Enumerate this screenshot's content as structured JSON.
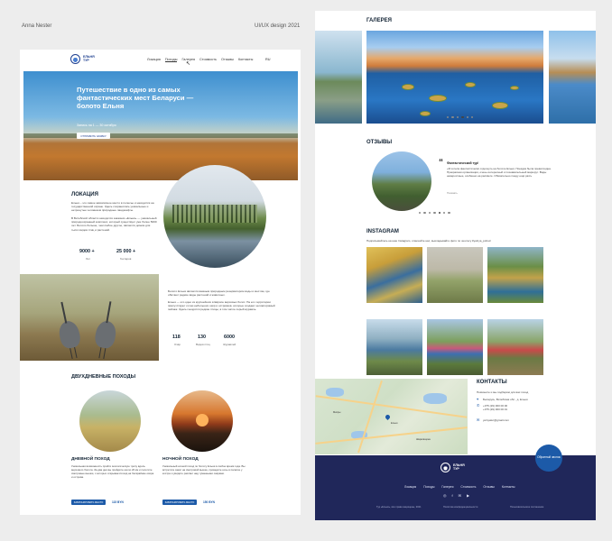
{
  "meta": {
    "author": "Anna Nester",
    "credit": "UI/UX design 2021"
  },
  "brand": {
    "name_line1": "ЕЛЬНЯ",
    "name_line2": "ТУР"
  },
  "nav": {
    "items": [
      "Локация",
      "Походы",
      "Галерея",
      "Стоимость",
      "Отзывы",
      "Контакты"
    ],
    "active": "Походы",
    "lang": "RU"
  },
  "hero": {
    "title": "Путешествие в одно из самых фантастических мест Беларуси — болото Ельня",
    "subtitle": "Запись на 1 — 30 октября",
    "button": "ОТПРАВИТЬ ЗАЯВКУ"
  },
  "location": {
    "heading": "ЛОКАЦИЯ",
    "para1": "Ельня – это самое живописное место в полесье и находится на государственной охране. Здесь сохранились уникальные и нетронутые человеком природные ландшафты.",
    "para2": "В Витебской области находится заказник «Ельня» — уникальный природоохранный комплекс, который существует уже более 5000 лет. Болото больше, чем любое другое, является домом для тысяч видов птиц и растений.",
    "stats": [
      {
        "value": "9000 +",
        "label": "Лет"
      },
      {
        "value": "25 000 +",
        "label": "Гектаров"
      }
    ]
  },
  "middle": {
    "para1": "Болото Ельня является важным природным резерватором воды и местом, где обитают редкие виды растений и животных.",
    "para2": "Ельня — это одно из крупнейших в Европе верховых болот. На его территории присутствуют сотни небольших озёр и островков, которые создают неповторимый пейзаж. Здесь гнездятся редкие птицы, в том числе серый журавль.",
    "stats": [
      {
        "value": "118",
        "label": "Озёр"
      },
      {
        "value": "130",
        "label": "Видов птиц"
      },
      {
        "value": "6000",
        "label": "Журавлей"
      }
    ]
  },
  "hikes": {
    "heading": "ДВУХДНЕВНЫЕ ПОХОДЫ",
    "cards": [
      {
        "title": "ДНЕВНОЙ ПОХОД",
        "text": "Уникальная возможность пройти экологическую тропу вдоль верхового болота. За два дня вы пройдёте около 20 км и посетите смотровые вышки, с которых открывается вид на бескрайние озёра и острова.",
        "button": "ЗАБРОНИРОВАТЬ МЕСТО",
        "price": "115 BYN"
      },
      {
        "title": "НОЧНОЙ ПОХОД",
        "text": "Уникальный ночной поход по болоту Ельня в любое время года. Вы встретите закат на смотровой вышке, проведёте ночь в палатке у костра и увидите рассвет над туманными озёрами.",
        "button": "ЗАБРОНИРОВАТЬ МЕСТО",
        "price": "150 BYN"
      }
    ]
  },
  "gallery": {
    "heading": "ГАЛЕРЕЯ",
    "dots": 6,
    "active_dot": 3
  },
  "reviews": {
    "heading": "ОТЗЫВЫ",
    "name": "Фантастический тур!",
    "text": "«Я хотела фантастически отдохнуть на болоте Ельня. Поездка была превосходна. Прекрасная организация, очень интересный и познавательный маршрут. Виды невероятные, особенно на рассвете. Обязательно поеду ещё раз!»",
    "link": "Показать",
    "dots": 7,
    "active_dot": 4
  },
  "instagram": {
    "heading": "INSTAGRAM",
    "subtitle": "Подписывайтесь на наш Instagram, отмечайте нас, выкладывайте фото по хештегу #yelnya_pohod"
  },
  "contacts": {
    "heading": "КОНТАКТЫ",
    "subtitle": "Позвоните и мы подберём для вас поход",
    "address": "Беларусь, Витебская обл., д. Ельня",
    "phone1": "+375 (29) 000 00 00",
    "phone2": "+375 (29) 000 00 01",
    "email": "yelnyatur@gmail.com",
    "fab": "Обратный звонок",
    "map_labels": [
      "Ельня",
      "Миоры",
      "Шарковщина"
    ]
  },
  "footer": {
    "nav": [
      "Локация",
      "Походы",
      "Галерея",
      "Стоимость",
      "Отзывы",
      "Контакты"
    ],
    "social": [
      "◎",
      "f",
      "✉",
      "▶"
    ],
    "cols": [
      "Тур «Ельня», все права защищены, 2021",
      "Политика конфиденциальности",
      "Пользовательское соглашение"
    ]
  },
  "colors": {
    "accent": "#1c5aa8",
    "footer": "#20275a"
  }
}
